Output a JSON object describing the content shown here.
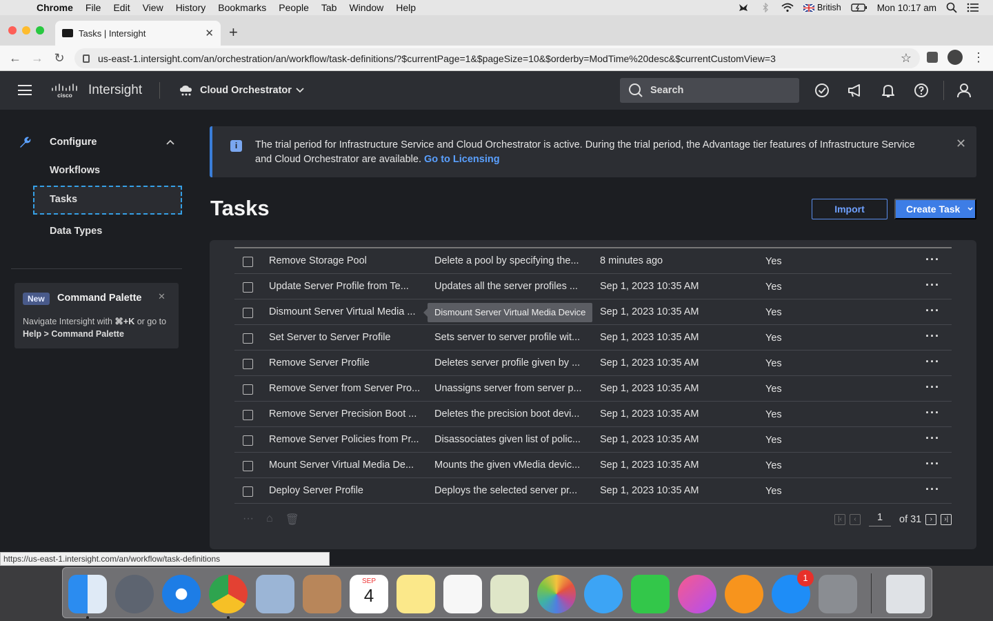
{
  "mac_menubar": {
    "app": "Chrome",
    "items": [
      "File",
      "Edit",
      "View",
      "History",
      "Bookmarks",
      "People",
      "Tab",
      "Window",
      "Help"
    ],
    "input_source": "British",
    "clock": "Mon 10:17 am"
  },
  "browser": {
    "tab_title": "Tasks | Intersight",
    "url": "us-east-1.intersight.com/an/orchestration/an/workflow/task-definitions/?$currentPage=1&$pageSize=10&$orderby=ModTime%20desc&$currentCustomView=3",
    "status_url": "https://us-east-1.intersight.com/an/workflow/task-definitions"
  },
  "header": {
    "logo_text": "cisco",
    "brand": "Intersight",
    "service": "Cloud Orchestrator",
    "search_placeholder": "Search"
  },
  "sidebar": {
    "section": "Configure",
    "items": [
      {
        "label": "Workflows"
      },
      {
        "label": "Tasks"
      },
      {
        "label": "Data Types"
      }
    ],
    "command_card": {
      "badge": "New",
      "title": "Command Palette",
      "desc_prefix": "Navigate Intersight with ",
      "shortcut": "⌘+K",
      "desc_mid": " or go to ",
      "path": "Help > Command Palette"
    }
  },
  "banner": {
    "message": "The trial period for Infrastructure Service and Cloud Orchestrator is active. During the trial period, the Advantage tier features of Infrastructure Service and Cloud Orchestrator are available.",
    "link": "Go to Licensing"
  },
  "page": {
    "title": "Tasks",
    "import_label": "Import",
    "create_label": "Create Task"
  },
  "table": {
    "rows": [
      {
        "name": "Remove Storage Pool",
        "desc": "Delete a pool by specifying the...",
        "modified": "8 minutes ago",
        "flag": "Yes"
      },
      {
        "name": "Update Server Profile from Te...",
        "desc": "Updates all the server profiles ...",
        "modified": "Sep 1, 2023 10:35 AM",
        "flag": "Yes"
      },
      {
        "name": "Dismount Server Virtual Media ...",
        "desc": "",
        "modified": "Sep 1, 2023 10:35 AM",
        "flag": "Yes"
      },
      {
        "name": "Set Server to Server Profile",
        "desc": "Sets server to server profile wit...",
        "modified": "Sep 1, 2023 10:35 AM",
        "flag": "Yes"
      },
      {
        "name": "Remove Server Profile",
        "desc": "Deletes server profile given by ...",
        "modified": "Sep 1, 2023 10:35 AM",
        "flag": "Yes"
      },
      {
        "name": "Remove Server from Server Pro...",
        "desc": "Unassigns server from server p...",
        "modified": "Sep 1, 2023 10:35 AM",
        "flag": "Yes"
      },
      {
        "name": "Remove Server Precision Boot ...",
        "desc": "Deletes the precision boot devi...",
        "modified": "Sep 1, 2023 10:35 AM",
        "flag": "Yes"
      },
      {
        "name": "Remove Server Policies from Pr...",
        "desc": "Disassociates given list of polic...",
        "modified": "Sep 1, 2023 10:35 AM",
        "flag": "Yes"
      },
      {
        "name": "Mount Server Virtual Media De...",
        "desc": "Mounts the given vMedia devic...",
        "modified": "Sep 1, 2023 10:35 AM",
        "flag": "Yes"
      },
      {
        "name": "Deploy Server Profile",
        "desc": "Deploys the selected server pr...",
        "modified": "Sep 1, 2023 10:35 AM",
        "flag": "Yes"
      }
    ],
    "tooltip": "Dismount Server Virtual Media Device",
    "pagination": {
      "current": "1",
      "of_label": "of 31"
    }
  },
  "dock": {
    "calendar_month": "SEP",
    "calendar_day": "4",
    "appstore_badge": "1"
  }
}
